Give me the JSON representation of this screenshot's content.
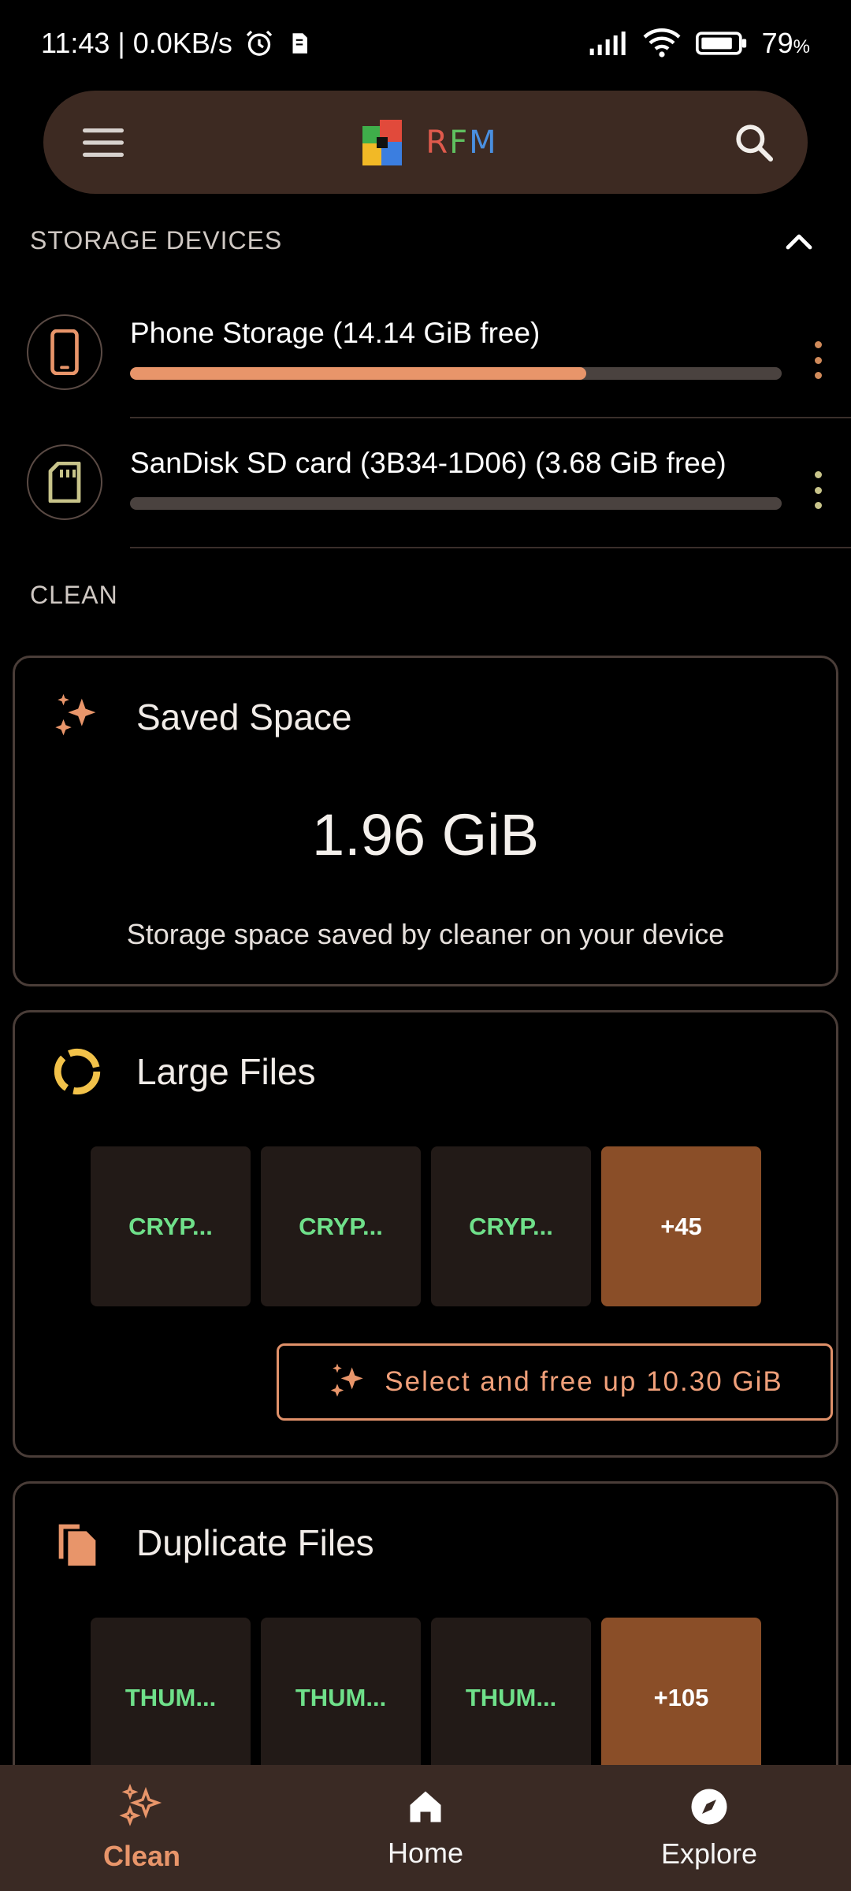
{
  "status_bar": {
    "time_speed": "11:43 | 0.0KB/s",
    "battery": "79",
    "battery_unit": "%"
  },
  "top_bar": {
    "logo_letters": [
      "R",
      "F",
      "M"
    ],
    "menu_icon": "hamburger-menu-icon",
    "search_icon": "search-icon"
  },
  "storage_section": {
    "header": "STORAGE DEVICES",
    "devices": [
      {
        "title": "Phone Storage (14.14 GiB free)",
        "used_fraction": 0.7,
        "icon": "phone-icon"
      },
      {
        "title": "SanDisk SD card (3B34-1D06) (3.68 GiB free)",
        "used_fraction": 0.0,
        "icon": "sd-card-icon"
      }
    ]
  },
  "clean_section": {
    "header": "CLEAN"
  },
  "saved_space": {
    "title": "Saved Space",
    "value": "1.96 GiB",
    "description": "Storage space saved by cleaner on your device"
  },
  "large_files": {
    "title": "Large Files",
    "tiles": [
      "CRYP...",
      "CRYP...",
      "CRYP..."
    ],
    "more": "+45",
    "action": "Select and free up 10.30 GiB"
  },
  "duplicate_files": {
    "title": "Duplicate Files",
    "tiles": [
      "THUM...",
      "THUM...",
      "THUM..."
    ],
    "more": "+105"
  },
  "bottom_nav": {
    "items": [
      {
        "label": "Clean",
        "icon": "sparkles-icon",
        "active": true
      },
      {
        "label": "Home",
        "icon": "home-icon",
        "active": false
      },
      {
        "label": "Explore",
        "icon": "compass-icon",
        "active": false
      }
    ]
  },
  "colors": {
    "accent": "#e8956a",
    "topbar_bg": "#3d2a22",
    "tile_text": "#6fe08a",
    "more_tile": "#8a4e28"
  }
}
